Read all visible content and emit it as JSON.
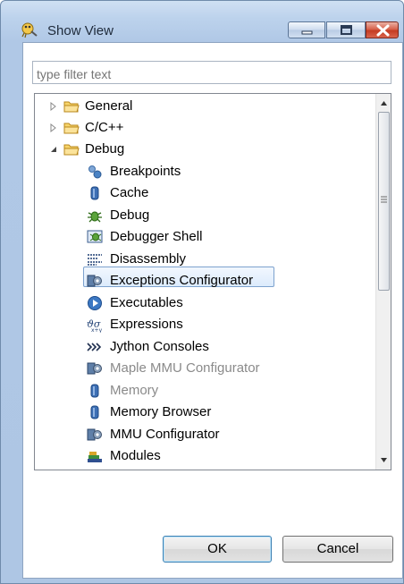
{
  "window": {
    "title": "Show View",
    "colors": {
      "frame": "#b0c8e6",
      "close": "#c43b22",
      "selection_border": "#7da2ce"
    }
  },
  "filter": {
    "placeholder": "type filter text"
  },
  "tree": {
    "items": [
      {
        "label": "General",
        "icon": "folder-icon",
        "kind": "folder",
        "expanded": false
      },
      {
        "label": "C/C++",
        "icon": "folder-icon",
        "kind": "folder",
        "expanded": false
      },
      {
        "label": "Debug",
        "icon": "folder-icon",
        "kind": "folder",
        "expanded": true
      },
      {
        "label": "Breakpoints",
        "icon": "breakpoints-icon"
      },
      {
        "label": "Cache",
        "icon": "cache-icon"
      },
      {
        "label": "Debug",
        "icon": "debug-bug-icon"
      },
      {
        "label": "Debugger Shell",
        "icon": "debugger-shell-icon"
      },
      {
        "label": "Disassembly",
        "icon": "disassembly-icon"
      },
      {
        "label": "Exceptions Configurator",
        "icon": "configurator-icon",
        "selected": true
      },
      {
        "label": "Executables",
        "icon": "executables-icon"
      },
      {
        "label": "Expressions",
        "icon": "expressions-icon"
      },
      {
        "label": "Jython Consoles",
        "icon": "jython-icon"
      },
      {
        "label": "Maple MMU Configurator",
        "icon": "configurator-icon",
        "disabled": true
      },
      {
        "label": "Memory",
        "icon": "memory-icon",
        "disabled": true
      },
      {
        "label": "Memory Browser",
        "icon": "memory-icon"
      },
      {
        "label": "MMU Configurator",
        "icon": "configurator-icon"
      },
      {
        "label": "Modules",
        "icon": "modules-icon"
      }
    ]
  },
  "buttons": {
    "ok": "OK",
    "cancel": "Cancel"
  }
}
